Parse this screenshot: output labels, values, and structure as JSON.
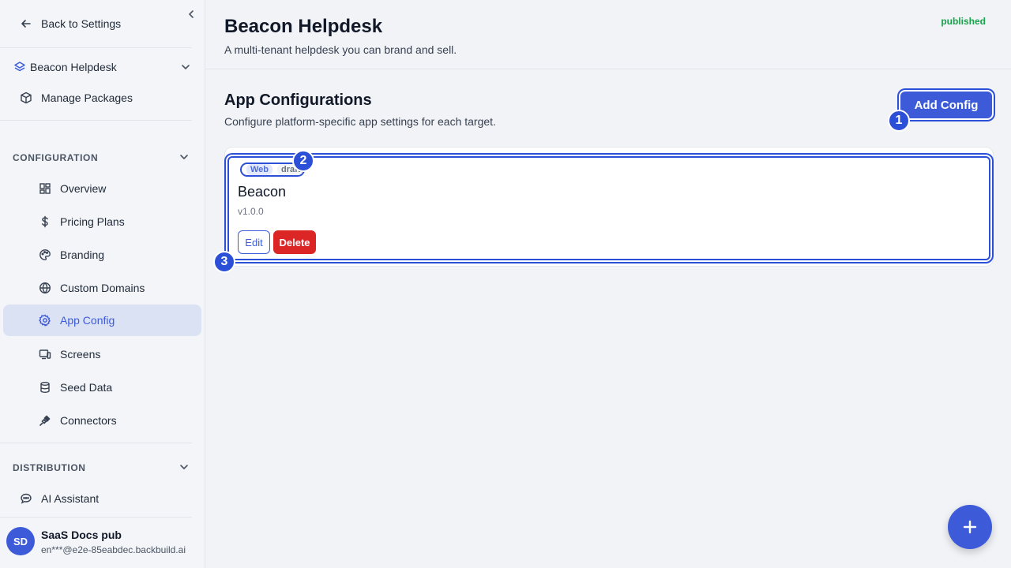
{
  "sidebar": {
    "back_label": "Back to Settings",
    "project_label": "Beacon Helpdesk",
    "manage_label": "Manage Packages",
    "config_section": "CONFIGURATION",
    "items": [
      {
        "label": "Overview",
        "icon": "grid-icon"
      },
      {
        "label": "Pricing Plans",
        "icon": "dollar-icon"
      },
      {
        "label": "Branding",
        "icon": "palette-icon"
      },
      {
        "label": "Custom Domains",
        "icon": "globe-icon"
      },
      {
        "label": "App Config",
        "icon": "gear-icon",
        "active": true
      },
      {
        "label": "Screens",
        "icon": "devices-icon"
      },
      {
        "label": "Seed Data",
        "icon": "database-icon"
      },
      {
        "label": "Connectors",
        "icon": "plug-icon"
      }
    ],
    "dist_section": "DISTRIBUTION",
    "ai_label": "AI Assistant",
    "user": {
      "initials": "SD",
      "name": "SaaS Docs pub",
      "email": "en***@e2e-85eabdec.backbuild.ai"
    }
  },
  "header": {
    "title": "Beacon Helpdesk",
    "subtitle": "A multi-tenant helpdesk you can brand and sell.",
    "status": "published"
  },
  "section": {
    "title": "App Configurations",
    "subtitle": "Configure platform-specific app settings for each target.",
    "add_label": "Add Config"
  },
  "config_card": {
    "platform_tag": "Web",
    "status_tag": "draft",
    "name": "Beacon",
    "version": "v1.0.0",
    "edit_label": "Edit",
    "delete_label": "Delete"
  },
  "badges": [
    "1",
    "2",
    "3"
  ],
  "colors": {
    "accent": "#3d5bd9",
    "danger": "#dc2626",
    "success": "#16a34a",
    "highlight": "#2c4fd8"
  }
}
